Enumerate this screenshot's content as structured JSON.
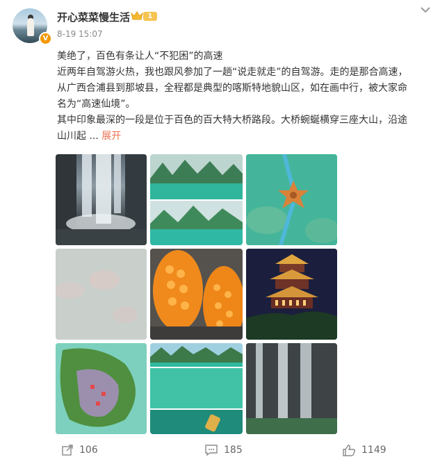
{
  "post": {
    "username": "开心菜菜慢生活",
    "level": "1",
    "verified_mark": "V",
    "time": "8-19 15:07",
    "lines": [
      "美绝了，百色有条让人“不犯困”的高速",
      "近两年自驾游火热，我也跟风参加了一趟“说走就走”的自驾游。走的是那合高速，",
      "从广西合浦县到那坡县，全程都是典型的喀斯特地貌山区，如在画中行，被大家命",
      "名为“高速仙境”。",
      "其中印象最深的一段是位于百色的百大特大桥路段。大桥蜿蜒横穿三座大山，沿途",
      "山川起 ..."
    ],
    "expand_label": "展开"
  },
  "icons": {
    "more": "chevron-down-icon",
    "crown": "crown-icon",
    "repost": "repost-icon",
    "comment": "comment-icon",
    "like": "like-icon"
  },
  "images": [
    {
      "desc": "waterfall"
    },
    {
      "desc": "karst-lake"
    },
    {
      "desc": "aerial-star-pavilion"
    },
    {
      "desc": "misty-sky"
    },
    {
      "desc": "pineapple-fruit"
    },
    {
      "desc": "night-pavilion"
    },
    {
      "desc": "island-aerial"
    },
    {
      "desc": "green-lake-boat"
    },
    {
      "desc": "waterfall-2"
    }
  ],
  "actions": {
    "repost_count": "106",
    "comment_count": "185",
    "like_count": "1149"
  },
  "colors": {
    "accent": "#eb7350",
    "level_badge": "#f5c451",
    "verified": "#f39800"
  }
}
